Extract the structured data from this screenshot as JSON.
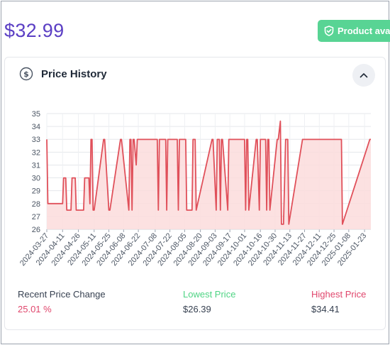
{
  "product": {
    "price": "$32.99",
    "availability_badge": "Product available",
    "badge_icon": "shield-check-icon"
  },
  "colors": {
    "price": "#5b3fc4",
    "badge": "#58d494",
    "series_line": "#e0505a",
    "series_fill": "#fcdcdc",
    "recent_change": "#e0466c",
    "lowest": "#4fd484",
    "highest": "#e0466c"
  },
  "card": {
    "title": "Price History",
    "title_icon": "dollar-circle-icon",
    "collapse_icon": "chevron-up-icon"
  },
  "stats": {
    "recent_change_label": "Recent Price Change",
    "recent_change_value": "25.01 %",
    "lowest_label": "Lowest Price",
    "lowest_value": "$26.39",
    "highest_label": "Highest Price",
    "highest_value": "$34.41"
  },
  "chart_data": {
    "type": "area",
    "ylim": [
      26,
      35
    ],
    "yticks": [
      "26",
      "27",
      "28",
      "29",
      "30",
      "31",
      "32",
      "33",
      "34",
      "35"
    ],
    "xticks": [
      "2024-03-27",
      "2024-04-11",
      "2024-04-26",
      "2024-05-11",
      "2024-05-25",
      "2024-06-08",
      "2024-06-22",
      "2024-07-08",
      "2024-07-22",
      "2024-08-05",
      "2024-08-20",
      "2024-09-03",
      "2024-09-17",
      "2024-10-01",
      "2024-10-16",
      "2024-10-30",
      "2024-11-13",
      "2024-11-27",
      "2024-12-11",
      "2024-12-25",
      "2025-01-08",
      "2025-01-23"
    ],
    "grid": true,
    "series": [
      {
        "x": [
          "2024-03-27",
          "2024-03-28",
          "2024-04-11",
          "2024-04-12",
          "2024-04-14",
          "2024-04-15",
          "2024-04-19",
          "2024-04-20",
          "2024-04-23",
          "2024-04-24",
          "2024-05-01",
          "2024-05-02",
          "2024-05-06",
          "2024-05-07",
          "2024-05-08",
          "2024-05-09",
          "2024-05-10",
          "2024-05-11",
          "2024-05-20",
          "2024-05-21",
          "2024-05-25",
          "2024-05-26",
          "2024-06-05",
          "2024-06-06",
          "2024-06-13",
          "2024-06-14",
          "2024-06-15",
          "2024-06-16",
          "2024-06-17",
          "2024-06-18",
          "2024-06-20",
          "2024-06-21",
          "2024-06-22",
          "2024-06-23",
          "2024-07-09",
          "2024-07-10",
          "2024-07-11",
          "2024-07-12",
          "2024-07-17",
          "2024-07-18",
          "2024-07-19",
          "2024-07-20",
          "2024-07-28",
          "2024-07-29",
          "2024-07-30",
          "2024-07-31",
          "2024-08-06",
          "2024-08-07",
          "2024-08-12",
          "2024-08-13",
          "2024-08-14",
          "2024-08-15",
          "2024-08-16",
          "2024-08-31",
          "2024-09-01",
          "2024-09-04",
          "2024-09-05",
          "2024-09-06",
          "2024-09-07",
          "2024-09-08",
          "2024-09-09",
          "2024-09-10",
          "2024-09-15",
          "2024-09-16",
          "2024-10-01",
          "2024-10-02",
          "2024-10-03",
          "2024-10-04",
          "2024-10-05",
          "2024-10-12",
          "2024-10-13",
          "2024-10-15",
          "2024-10-16",
          "2024-10-21",
          "2024-10-22",
          "2024-10-23",
          "2024-10-24",
          "2024-10-25",
          "2024-11-01",
          "2024-11-02",
          "2024-11-04",
          "2024-11-05",
          "2024-11-07",
          "2024-11-09",
          "2024-11-10",
          "2024-11-11",
          "2024-11-12",
          "2024-11-25",
          "2024-11-26",
          "2024-12-06",
          "2024-12-07",
          "2024-12-09",
          "2024-12-10",
          "2024-12-15",
          "2024-12-16",
          "2024-12-17",
          "2024-12-18",
          "2024-12-19",
          "2024-12-20",
          "2025-01-01",
          "2025-01-02",
          "2025-01-28",
          "2025-01-29"
        ],
        "y": [
          32.99,
          28.0,
          28.0,
          30.0,
          30.0,
          27.49,
          27.49,
          30.0,
          30.0,
          27.49,
          27.49,
          30.0,
          30.0,
          27.99,
          32.99,
          32.99,
          27.49,
          27.49,
          32.99,
          32.99,
          27.49,
          27.49,
          32.99,
          32.99,
          27.49,
          32.99,
          32.99,
          27.49,
          32.99,
          32.99,
          31.0,
          32.99,
          32.99,
          32.99,
          32.99,
          32.99,
          27.49,
          32.99,
          32.99,
          32.99,
          27.49,
          32.99,
          32.99,
          32.99,
          27.49,
          32.99,
          32.99,
          27.49,
          27.49,
          32.99,
          32.99,
          32.99,
          27.49,
          32.99,
          32.99,
          27.49,
          32.99,
          32.99,
          32.99,
          27.49,
          32.99,
          32.99,
          27.49,
          32.99,
          32.99,
          27.49,
          32.99,
          32.99,
          27.49,
          32.99,
          32.99,
          27.49,
          32.99,
          32.99,
          27.49,
          32.99,
          32.99,
          27.49,
          32.99,
          32.99,
          34.41,
          26.39,
          26.39,
          32.99,
          32.99,
          32.99,
          26.39,
          32.99,
          32.99,
          32.99,
          32.99,
          32.99,
          32.99,
          32.99,
          32.99,
          32.99,
          32.99,
          32.99,
          32.99,
          32.99,
          26.39,
          32.99,
          32.99
        ]
      }
    ]
  }
}
